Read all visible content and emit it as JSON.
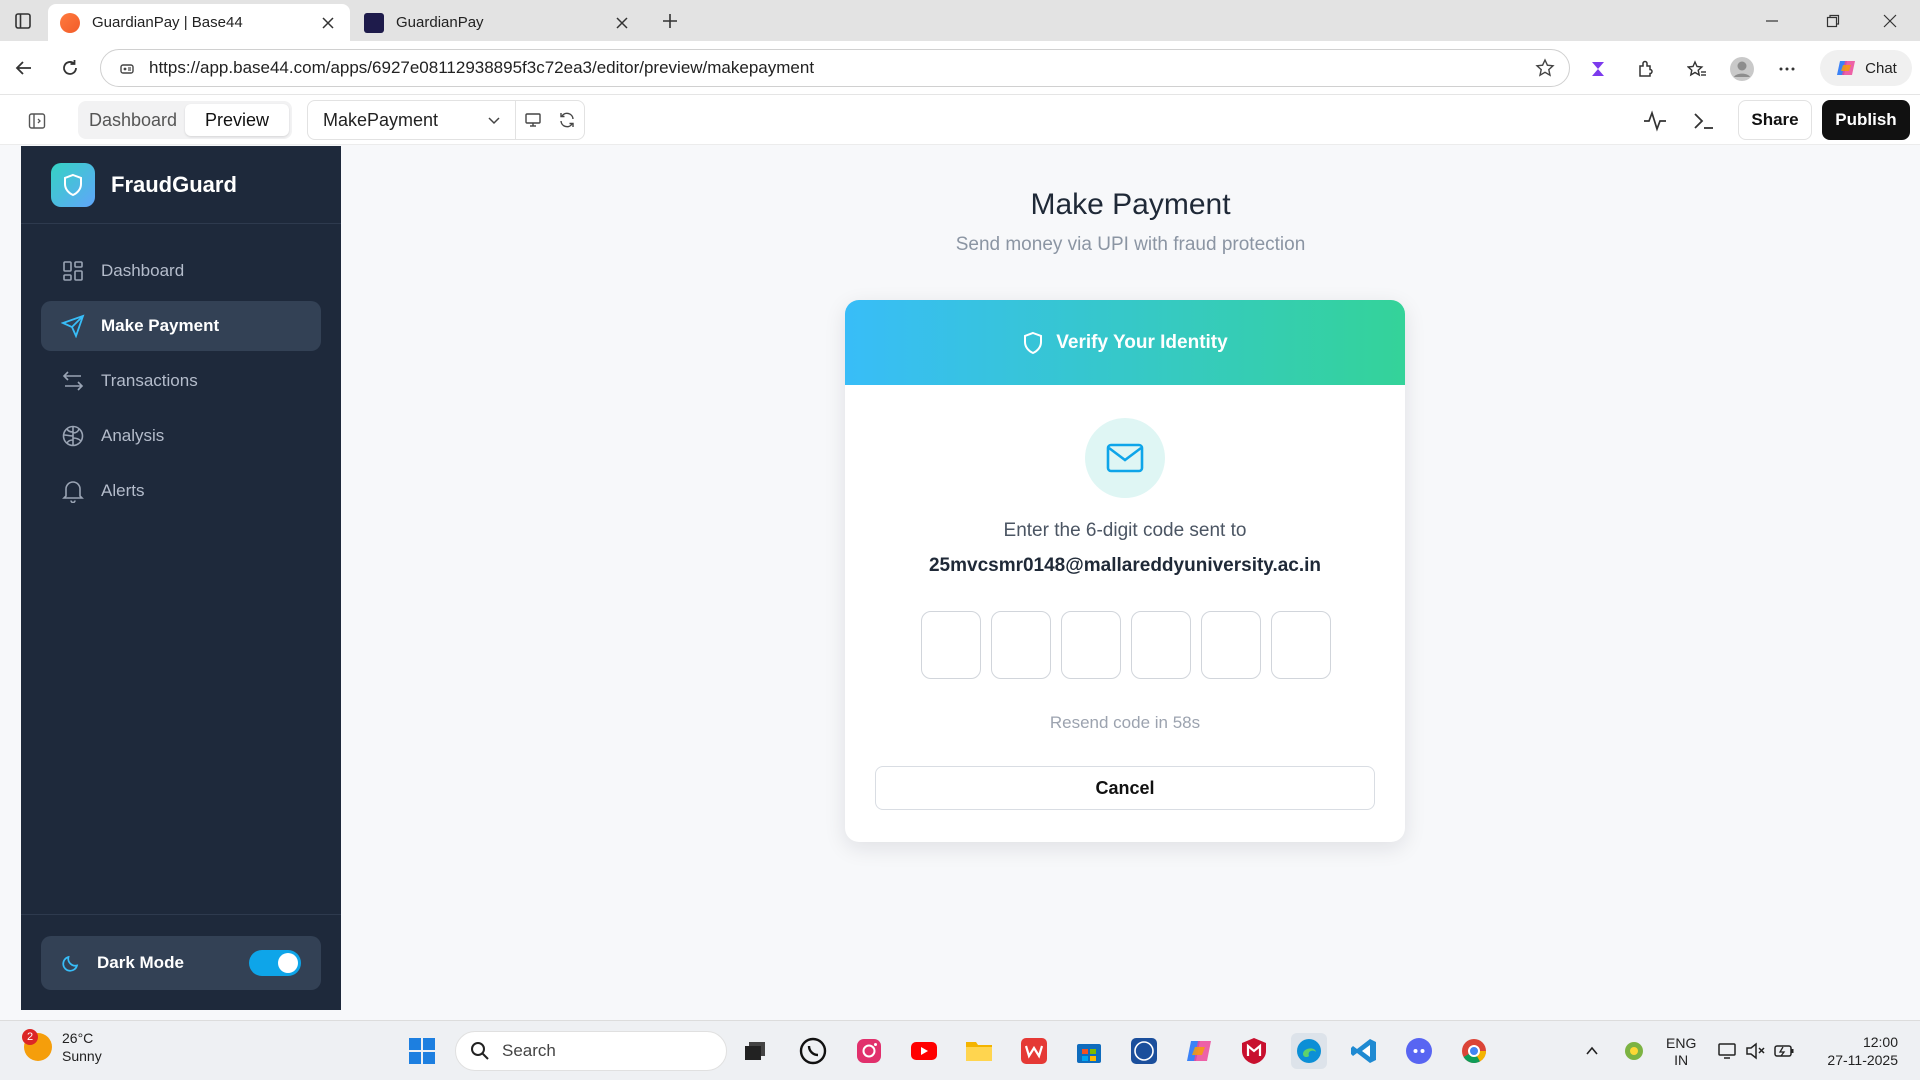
{
  "browser": {
    "tabs": [
      {
        "title": "GuardianPay | Base44",
        "active": true
      },
      {
        "title": "GuardianPay",
        "active": false
      }
    ],
    "url": "https://app.base44.com/apps/6927e08112938895f3c72ea3/editor/preview/makepayment",
    "chat_label": "Chat"
  },
  "editor": {
    "segments": [
      "Dashboard",
      "Preview"
    ],
    "active_segment": "Preview",
    "page_select": "MakePayment",
    "share_label": "Share",
    "publish_label": "Publish"
  },
  "sidebar": {
    "brand": "FraudGuard",
    "items": [
      {
        "label": "Dashboard",
        "icon": "grid-icon"
      },
      {
        "label": "Make Payment",
        "icon": "send-icon",
        "active": true
      },
      {
        "label": "Transactions",
        "icon": "arrows-icon"
      },
      {
        "label": "Analysis",
        "icon": "brain-icon"
      },
      {
        "label": "Alerts",
        "icon": "bell-icon"
      }
    ],
    "dark_mode_label": "Dark Mode",
    "dark_mode_on": true
  },
  "main": {
    "title": "Make Payment",
    "subtitle": "Send money via UPI with fraud protection",
    "card": {
      "header": "Verify Your Identity",
      "instruction": "Enter the 6-digit code sent to",
      "email": "25mvcsmr0148@mallareddyuniversity.ac.in",
      "otp_values": [
        "",
        "",
        "",
        "",
        "",
        ""
      ],
      "resend_text": "Resend code in 58s",
      "cancel_label": "Cancel"
    }
  },
  "taskbar": {
    "weather_temp": "26°C",
    "weather_desc": "Sunny",
    "weather_badge": "2",
    "search_label": "Search",
    "lang_top": "ENG",
    "lang_bottom": "IN",
    "time": "12:00",
    "date": "27-11-2025"
  },
  "colors": {
    "sidebar_bg": "#1e293b",
    "accent_from": "#38bdf8",
    "accent_to": "#34d399",
    "publish_bg": "#111111"
  }
}
